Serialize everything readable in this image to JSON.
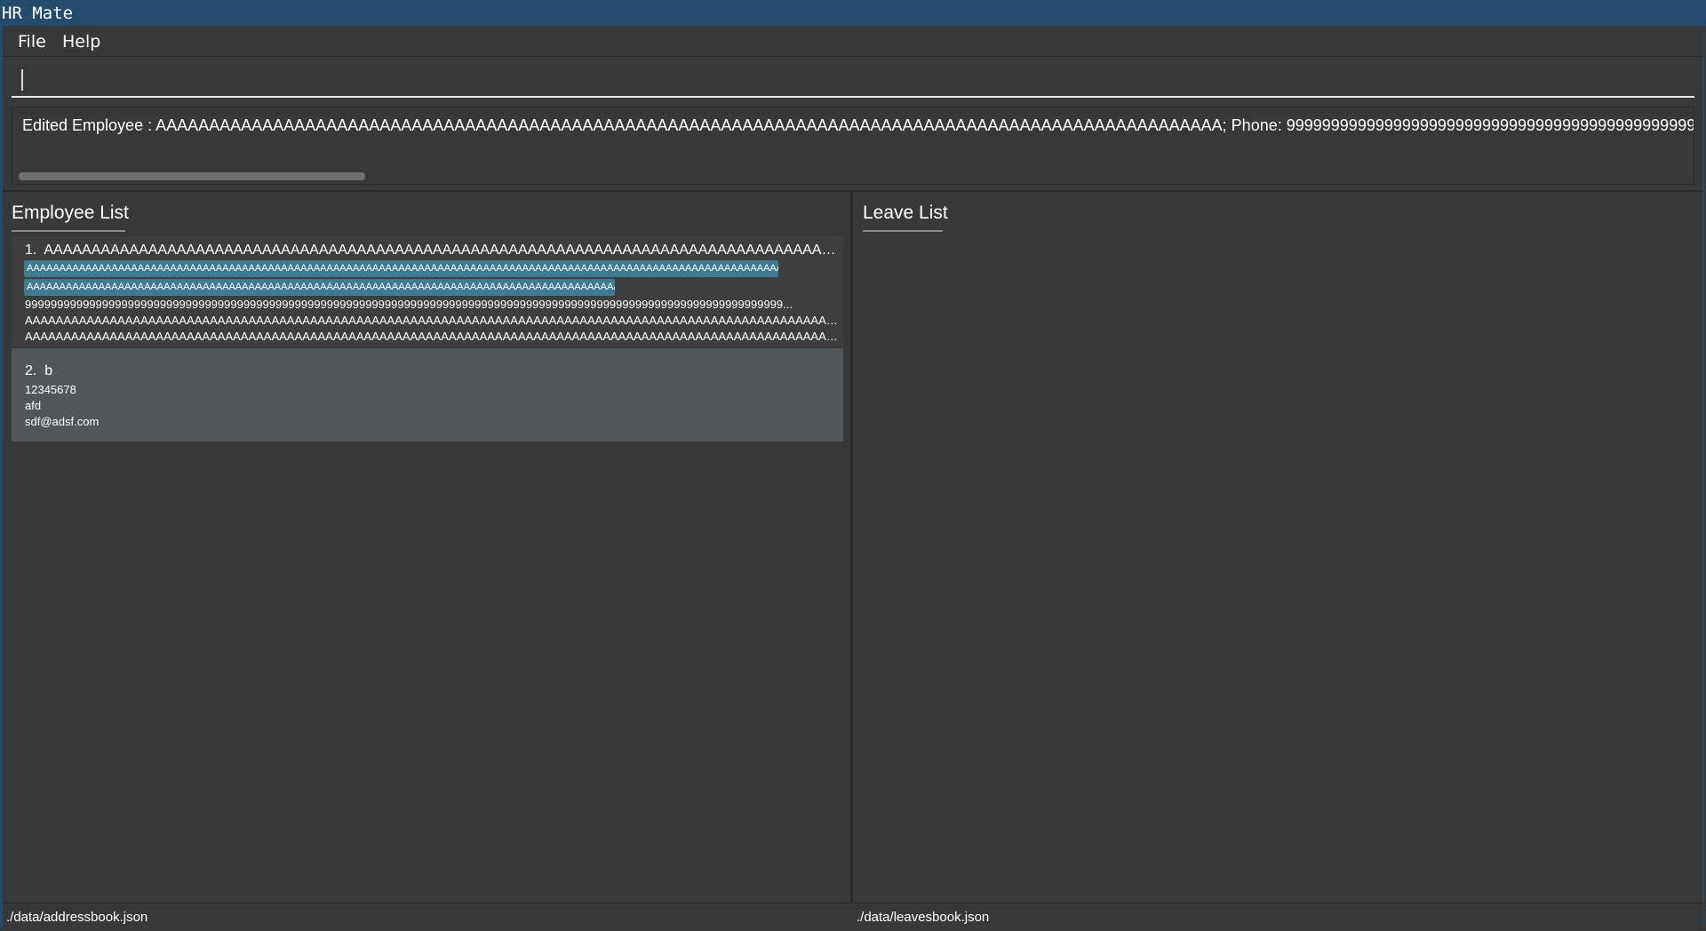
{
  "window": {
    "title": "HR Mate"
  },
  "menu": {
    "file": "File",
    "help": "Help"
  },
  "command": {
    "value": ""
  },
  "result": {
    "text": "Edited Employee : AAAAAAAAAAAAAAAAAAAAAAAAAAAAAAAAAAAAAAAAAAAAAAAAAAAAAAAAAAAAAAAAAAAAAAAAAAAAAAAAAAAAAAAAAAAAAAAAAAAA; Phone: 999999999999999999999999999999999999999999999999999999999"
  },
  "employee_panel": {
    "title": "Employee List",
    "employees": [
      {
        "index": "1.",
        "name": "AAAAAAAAAAAAAAAAAAAAAAAAAAAAAAAAAAAAAAAAAAAAAAAAAAAAAAAAAAAAAAAAAAAAAAAAAAAAAAAAAAAAAAAAAAAAAAAA...",
        "tags": [
          "AAAAAAAAAAAAAAAAAAAAAAAAAAAAAAAAAAAAAAAAAAAAAAAAAAAAAAAAAAAAAAAAAAAAAAAAAAAAAAAAAAAAAAAAAAAAAAAAAAAAAAAAAAAAAAAAAAAAAAAAAAAAAAAAAAAAAAAa",
          "AAAAAAAAAAAAAAAAAAAAAAAAAAAAAAAAAAAAAAAAAAAAAAAAAAAAAAAAAAAAAAAAAAAAAAAAAAAAAAAAAAAAAAAAAAAAAAAAAAAAAAAAAAAAAa"
        ],
        "phone": "9999999999999999999999999999999999999999999999999999999999999999999999999999999999999999999999999999999999999999999999...",
        "address": "AAAAAAAAAAAAAAAAAAAAAAAAAAAAAAAAAAAAAAAAAAAAAAAAAAAAAAAAAAAAAAAAAAAAAAAAAAAAAAAAAAAAAAAAAAAAAAAAAAAAAAAAAAAAAAAAAAAAAAAA...",
        "email": "AAAAAAAAAAAAAAAAAAAAAAAAAAAAAAAAAAAAAAAAAAAAAAAAAAAAAAAAAAAAAAAAAAAAAAAAAAAAAAAAAAAAAAAAAAAAAAAAAAAAAAAAAAAAAAAAAAAAA@..."
      },
      {
        "index": "2.",
        "name": "b",
        "phone": "12345678",
        "address": "afd",
        "email": "sdf@adsf.com"
      }
    ]
  },
  "leave_panel": {
    "title": "Leave List"
  },
  "status": {
    "employee_file": "./data/addressbook.json",
    "leave_file": "./data/leavesbook.json"
  },
  "colors": {
    "title_bar": "#244b6b",
    "background": "#383838",
    "tag": "#3e7b91",
    "selected_card": "#515658"
  }
}
